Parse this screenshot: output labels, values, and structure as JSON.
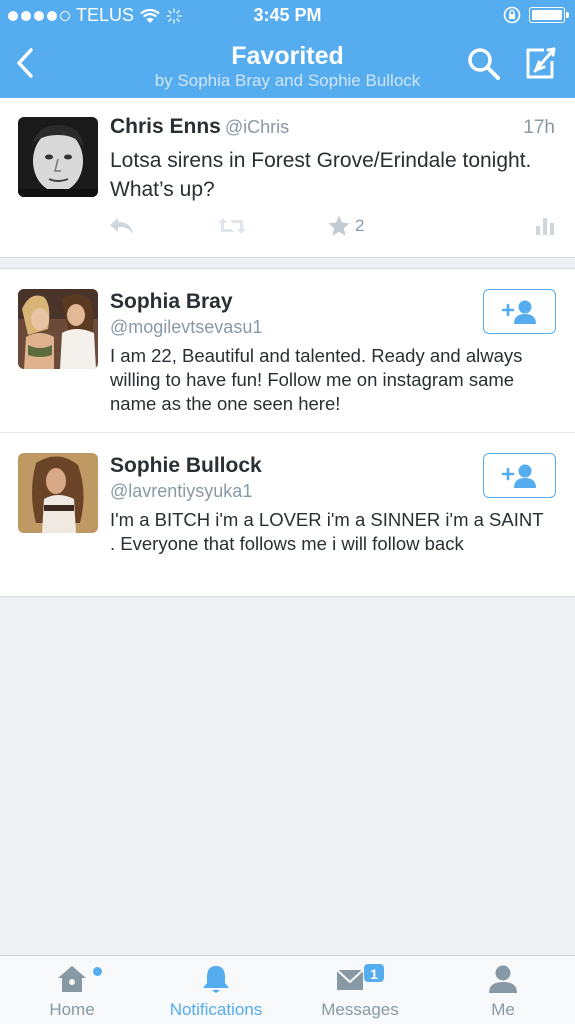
{
  "status_bar": {
    "carrier": "TELUS",
    "time": "3:45 PM"
  },
  "nav": {
    "title": "Favorited",
    "subtitle": "by Sophia Bray and Sophie Bullock"
  },
  "tweet": {
    "name": "Chris Enns",
    "handle": "@iChris",
    "time": "17h",
    "text": "Lotsa sirens in Forest Grove/Erindale tonight. What’s up?",
    "favorites": "2"
  },
  "users": [
    {
      "name": "Sophia Bray",
      "handle": "@mogilevtsevasu1",
      "bio": "I am 22, Beautiful and talented. Ready and always willing to have fun! Follow me on instagram same name as the one seen here!"
    },
    {
      "name": "Sophie Bullock",
      "handle": "@lavrentiysyuka1",
      "bio": "I'm a BITCH i'm a LOVER i'm a SINNER i'm a SAINT . Everyone that follows me i will follow back"
    }
  ],
  "tabs": {
    "home": "Home",
    "notifications": "Notifications",
    "messages": "Messages",
    "messages_badge": "1",
    "me": "Me"
  },
  "colors": {
    "brand": "#55acee",
    "header_subtitle": "#cfe6fa",
    "secondary_text": "#8899a6",
    "background": "#eef1f4"
  }
}
